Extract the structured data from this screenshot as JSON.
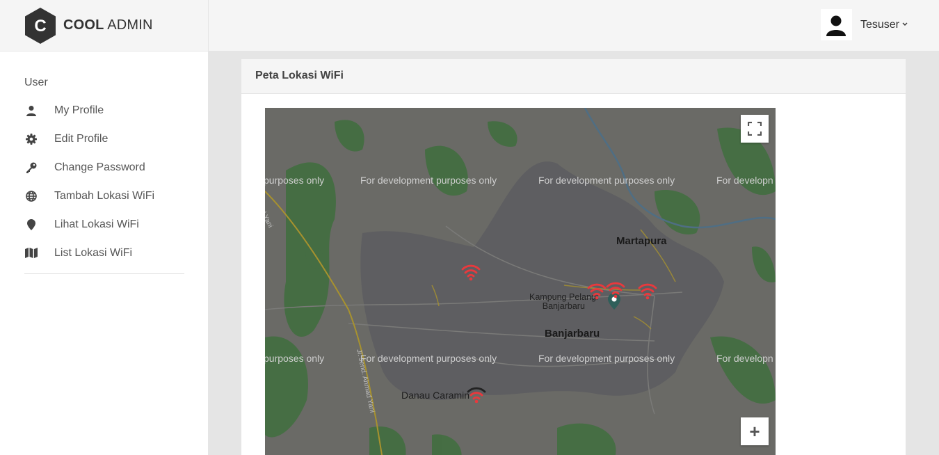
{
  "brand": {
    "bold": "COOL",
    "light": "ADMIN",
    "logo_letter": "C"
  },
  "header": {
    "user_name": "Tesuser",
    "caret": "⌄"
  },
  "sidebar": {
    "heading": "User",
    "items": [
      {
        "label": "My Profile",
        "icon": "user-icon"
      },
      {
        "label": "Edit Profile",
        "icon": "gear-icon"
      },
      {
        "label": "Change Password",
        "icon": "key-icon"
      },
      {
        "label": "Tambah Lokasi WiFi",
        "icon": "globe-icon"
      },
      {
        "label": "Lihat Lokasi WiFi",
        "icon": "map-pin-icon"
      },
      {
        "label": "List Lokasi WiFi",
        "icon": "map-icon"
      }
    ]
  },
  "card": {
    "title": "Peta Lokasi WiFi"
  },
  "map": {
    "watermark": "For development purposes only",
    "watermark_partial_left": "purposes only",
    "watermark_partial_right": "For developn",
    "places": {
      "martapura": "Martapura",
      "kampung_line1": "Kampung Pelangi",
      "kampung_line2": "Banjarbaru",
      "banjarbaru": "Banjarbaru",
      "danau": "Danau Caramin",
      "road": "Jl. Jend. Ahmad Yani",
      "road_top": "ad Yani"
    },
    "zoom_in_label": "+",
    "marker_color": "#e8393d"
  }
}
